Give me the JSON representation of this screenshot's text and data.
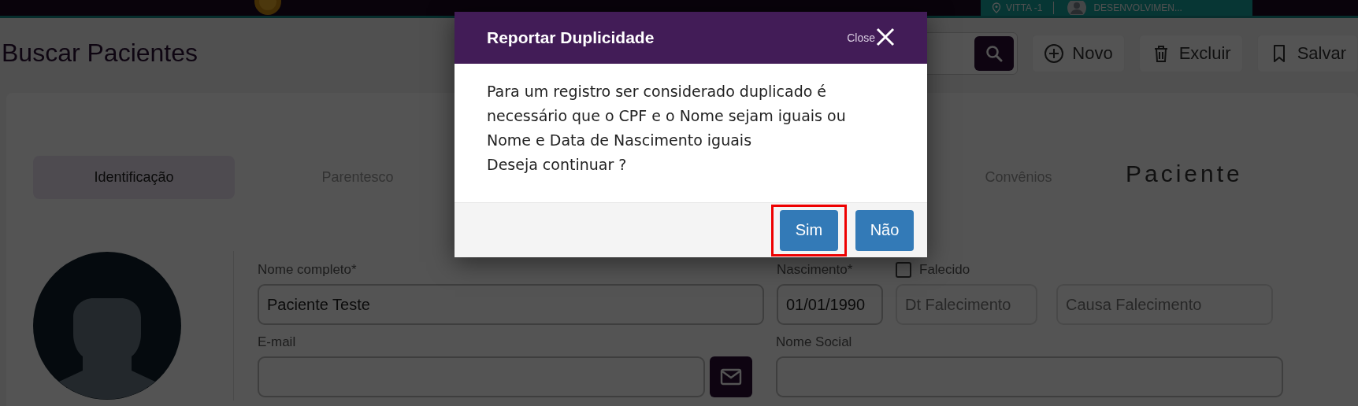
{
  "topbar": {
    "unit": "VITTA -1",
    "user": "DESENVOLVIMEN..."
  },
  "page": {
    "title": "Buscar Pacientes",
    "actions": [
      {
        "label": "Novo",
        "kind": "plus"
      },
      {
        "label": "Excluir",
        "kind": "trash"
      },
      {
        "label": "Salvar",
        "kind": "bookmark"
      }
    ]
  },
  "tabs": [
    {
      "label": "Identificação",
      "selected": true
    },
    {
      "label": "Parentesco",
      "selected": false
    },
    {
      "label": "Convênios",
      "selected": false
    }
  ],
  "section_title": "Paciente",
  "form": {
    "full_name": {
      "label": "Nome completo*",
      "value": "Paciente Teste"
    },
    "birth": {
      "label": "Nascimento*",
      "value": "01/01/1990"
    },
    "deceased": {
      "label": "Falecido",
      "checked": false
    },
    "death_date": {
      "placeholder": "Dt Falecimento"
    },
    "death_cause": {
      "placeholder": "Causa Falecimento"
    },
    "email": {
      "label": "E-mail"
    },
    "social_name": {
      "label": "Nome Social"
    }
  },
  "dialog": {
    "title": "Reportar Duplicidade",
    "close_label": "Close",
    "message": [
      "Para um registro ser considerado duplicado é necessário que o CPF e o Nome sejam iguais ou Nome e Data de Nascimento iguais",
      "Deseja continuar ?"
    ],
    "buttons": [
      {
        "label": "Sim",
        "highlighted": true
      },
      {
        "label": "Não",
        "highlighted": false
      }
    ]
  }
}
